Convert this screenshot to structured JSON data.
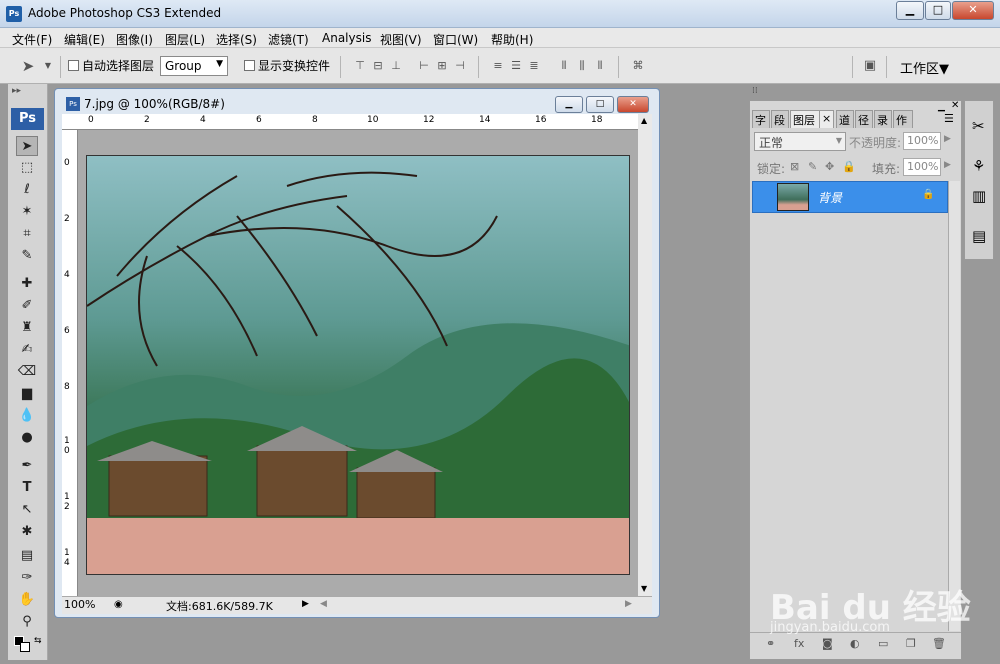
{
  "app": {
    "title": "Adobe Photoshop CS3 Extended",
    "icon_text": "Ps"
  },
  "window_buttons": {
    "minimize": "▁",
    "maximize": "□",
    "close": "✕"
  },
  "menu": [
    "文件(F)",
    "编辑(E)",
    "图像(I)",
    "图层(L)",
    "选择(S)",
    "滤镜(T)",
    "Analysis",
    "视图(V)",
    "窗口(W)",
    "帮助(H)"
  ],
  "options": {
    "auto_select_label": "自动选择图层",
    "group_value": "Group",
    "show_transform_label": "显示变换控件",
    "workspace": "工作区▼"
  },
  "toolbox": {
    "logo": "Ps"
  },
  "document": {
    "title": "7.jpg @ 100%(RGB/8#)",
    "icon_text": "Ps",
    "ruler_top": [
      "0",
      "2",
      "4",
      "6",
      "8",
      "10",
      "12",
      "14",
      "16",
      "18"
    ],
    "ruler_left": [
      "0",
      "2",
      "4",
      "6",
      "8",
      "1 0",
      "1 2",
      "1 4"
    ],
    "zoom": "100%",
    "info": "文档:681.6K/589.7K"
  },
  "layers_panel": {
    "tabs": [
      "字",
      "段",
      "图层",
      "×",
      "道",
      "径",
      "录",
      "作"
    ],
    "blend_mode": "正常",
    "opacity_label": "不透明度:",
    "opacity": "100%",
    "lock_label": "锁定:",
    "fill_label": "填充:",
    "fill": "100%",
    "layer_name": "背景"
  },
  "watermark": {
    "text": "Bai du 经验",
    "sub": "jingyan.baidu.com"
  },
  "colors": {
    "layer_selected": "#3b8fea",
    "bottom_band": "#d9a091",
    "sky": "#8fbfc4"
  }
}
